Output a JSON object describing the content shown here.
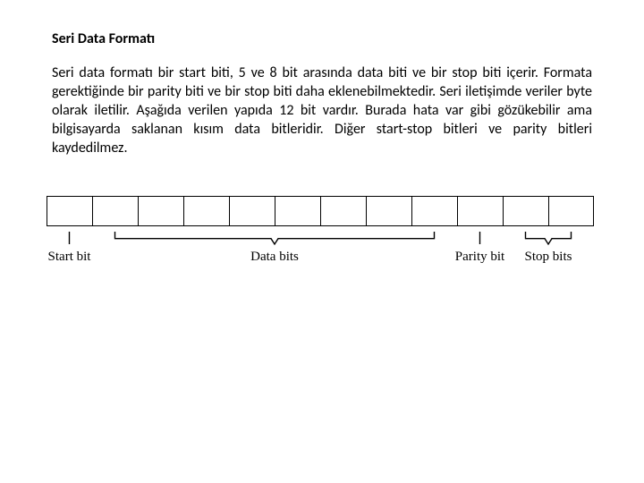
{
  "heading": "Seri Data Formatı",
  "body": "Seri data formatı bir start biti, 5 ve 8 bit arasında data biti ve bir stop biti içerir. Formata gerektiğinde bir parity biti ve bir stop biti daha eklenebilmektedir.  Seri iletişimde veriler byte olarak iletilir. Aşağıda verilen yapıda 12 bit vardır. Burada hata var gibi gözükebilir ama bilgisayarda saklanan kısım data bitleridir. Diğer start-stop bitleri ve parity bitleri kaydedilmez.",
  "diagram": {
    "cell_count": 12,
    "groups": [
      {
        "label": "Start bit",
        "cells": [
          1,
          1
        ]
      },
      {
        "label": "Data bits",
        "cells": [
          2,
          9
        ]
      },
      {
        "label": "Parity bit",
        "cells": [
          10,
          10
        ]
      },
      {
        "label": "Stop bits",
        "cells": [
          11,
          12
        ]
      }
    ]
  }
}
